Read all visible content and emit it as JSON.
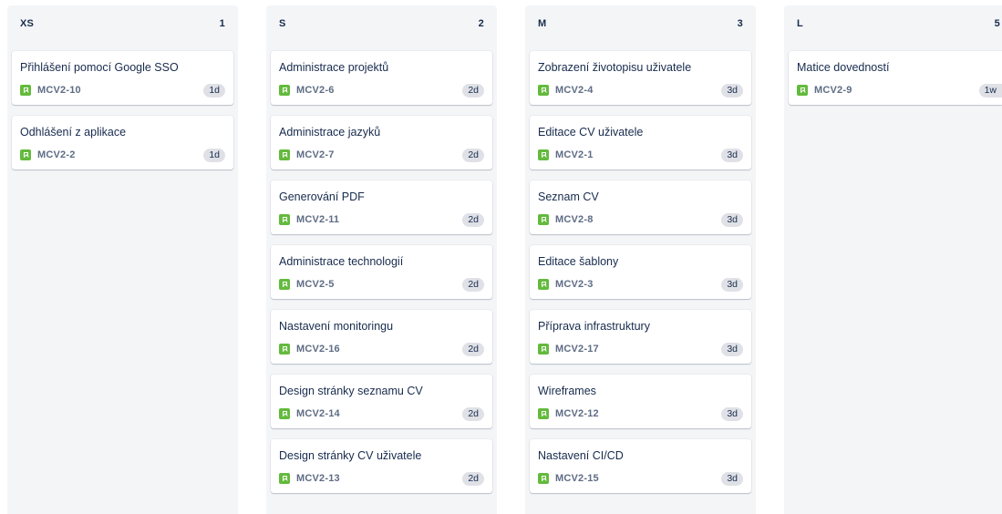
{
  "columns": [
    {
      "title": "XS",
      "count": "1",
      "cards": [
        {
          "title": "Přihlášení pomocí Google SSO",
          "key": "MCV2-10",
          "estimate": "1d"
        },
        {
          "title": "Odhlášení z aplikace",
          "key": "MCV2-2",
          "estimate": "1d"
        }
      ]
    },
    {
      "title": "S",
      "count": "2",
      "cards": [
        {
          "title": "Administrace projektů",
          "key": "MCV2-6",
          "estimate": "2d"
        },
        {
          "title": "Administrace jazyků",
          "key": "MCV2-7",
          "estimate": "2d"
        },
        {
          "title": "Generování PDF",
          "key": "MCV2-11",
          "estimate": "2d"
        },
        {
          "title": "Administrace technologií",
          "key": "MCV2-5",
          "estimate": "2d"
        },
        {
          "title": "Nastavení monitoringu",
          "key": "MCV2-16",
          "estimate": "2d"
        },
        {
          "title": "Design stránky seznamu CV",
          "key": "MCV2-14",
          "estimate": "2d"
        },
        {
          "title": "Design stránky CV uživatele",
          "key": "MCV2-13",
          "estimate": "2d"
        }
      ]
    },
    {
      "title": "M",
      "count": "3",
      "cards": [
        {
          "title": "Zobrazení životopisu uživatele",
          "key": "MCV2-4",
          "estimate": "3d"
        },
        {
          "title": "Editace CV uživatele",
          "key": "MCV2-1",
          "estimate": "3d"
        },
        {
          "title": "Seznam CV",
          "key": "MCV2-8",
          "estimate": "3d"
        },
        {
          "title": "Editace šablony",
          "key": "MCV2-3",
          "estimate": "3d"
        },
        {
          "title": "Příprava infrastruktury",
          "key": "MCV2-17",
          "estimate": "3d"
        },
        {
          "title": "Wireframes",
          "key": "MCV2-12",
          "estimate": "3d"
        },
        {
          "title": "Nastavení CI/CD",
          "key": "MCV2-15",
          "estimate": "3d"
        }
      ]
    },
    {
      "title": "L",
      "count": "5",
      "cards": [
        {
          "title": "Matice dovedností",
          "key": "MCV2-9",
          "estimate": "1w"
        }
      ]
    }
  ],
  "colors": {
    "column_bg": "#f4f5f7",
    "story_icon": "#63ba3c",
    "estimate_badge": "#dfe1e6",
    "text_primary": "#172b4d",
    "text_secondary": "#5e6c84"
  },
  "icons": {
    "issue_type": "story-icon"
  }
}
